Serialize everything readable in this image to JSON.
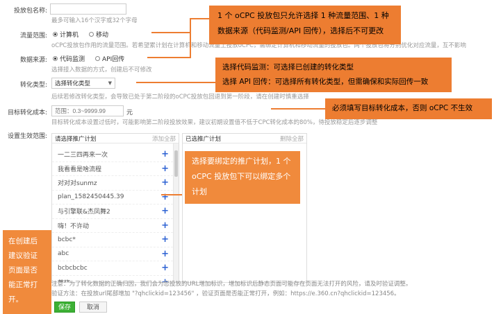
{
  "form": {
    "name_label": "投放包名称:",
    "name_value": "",
    "name_hint": "最多可输入16个汉字或32个字母",
    "traffic_label": "流量范围:",
    "traffic_options": [
      {
        "label": "计算机",
        "selected": true
      },
      {
        "label": "移动",
        "selected": false
      }
    ],
    "traffic_hint": "oCPC投放包作用的流量范围。若希望累计划在计算机和移动流量上投放oCPC，需绑定计算机和移动流量的投放包。两个投放包将分别优化对应流量，互不影响",
    "source_label": "数据来源:",
    "source_options": [
      {
        "label": "代码监测",
        "selected": true
      },
      {
        "label": "API回传",
        "selected": false
      }
    ],
    "source_hint": "选择接入数据的方式，创建后不可修改",
    "conv_type_label": "转化类型:",
    "conv_type_value": "选择转化类型",
    "conv_type_hint": "后续若修改转化类型，会导致已处于第二阶段的oCPC投放包回退到第一阶段，请在创建时慎重选择",
    "target_label": "目标转化成本:",
    "target_placeholder": "范围：0.3~9999.99",
    "target_unit": "元",
    "target_hint": "目标转化成本设置过低时，可能影响第二阶段投放效果，建议初期设置值不低于CPC转化成本的80%，待投放稳定后逐步调整",
    "scope_label": "设置生效范围:"
  },
  "left_panel": {
    "title": "请选择推广计划",
    "action": "添加全部",
    "items": [
      "一二三四再来一次",
      "我看看是啥流程",
      "对对对sunmz",
      "plan_1582450445.39",
      "与引擎联&杰凤舞2",
      "嗨！不许动",
      "bcbc*",
      "abc",
      "bcbcbcbc",
      "范晓"
    ]
  },
  "right_panel": {
    "title": "已选推广计划",
    "action": "删除全部"
  },
  "notes": {
    "note1": "注意：为了转化数据的正确归因，我们会为您投放的URL增加标识，增加标识后静态页面可能存在页面无法打开的风险，请及时验证调整。",
    "note2": "验证方法：在投放url尾部增加 \"?qhclickid=123456\" ，验证页面是否能正常打开，例如：https://e.360.cn?qhclickid=123456。"
  },
  "buttons": {
    "save": "保存",
    "cancel": "取消"
  },
  "callouts": {
    "c1_line1": "1 个 oCPC 投放包只允许选择 1 种流量范围、1 种",
    "c1_line2": "数据来源（代码监测/API 回传），选择后不可更改",
    "c2_line1": "选择代码监测：可选择已创建的转化类型",
    "c2_line2": "选择 API 回传：可选择所有转化类型，但需确保和实际回传一致",
    "c3": "必须填写目标转化成本，否则 oCPC 不生效",
    "c4_line1": "选择要绑定的推广计划，1 个",
    "c4_line2": "oCPC 投放包下可以绑定多个",
    "c4_line3": "计划",
    "c5_line1": "在创建后",
    "c5_line2": "建议验证",
    "c5_line3": "页面是否",
    "c5_line4": "能正常打",
    "c5_line5": "开。"
  },
  "colors": {
    "callout": "#ed7d31",
    "save_button": "#3cb034",
    "plus_icon": "#2d62d3"
  }
}
